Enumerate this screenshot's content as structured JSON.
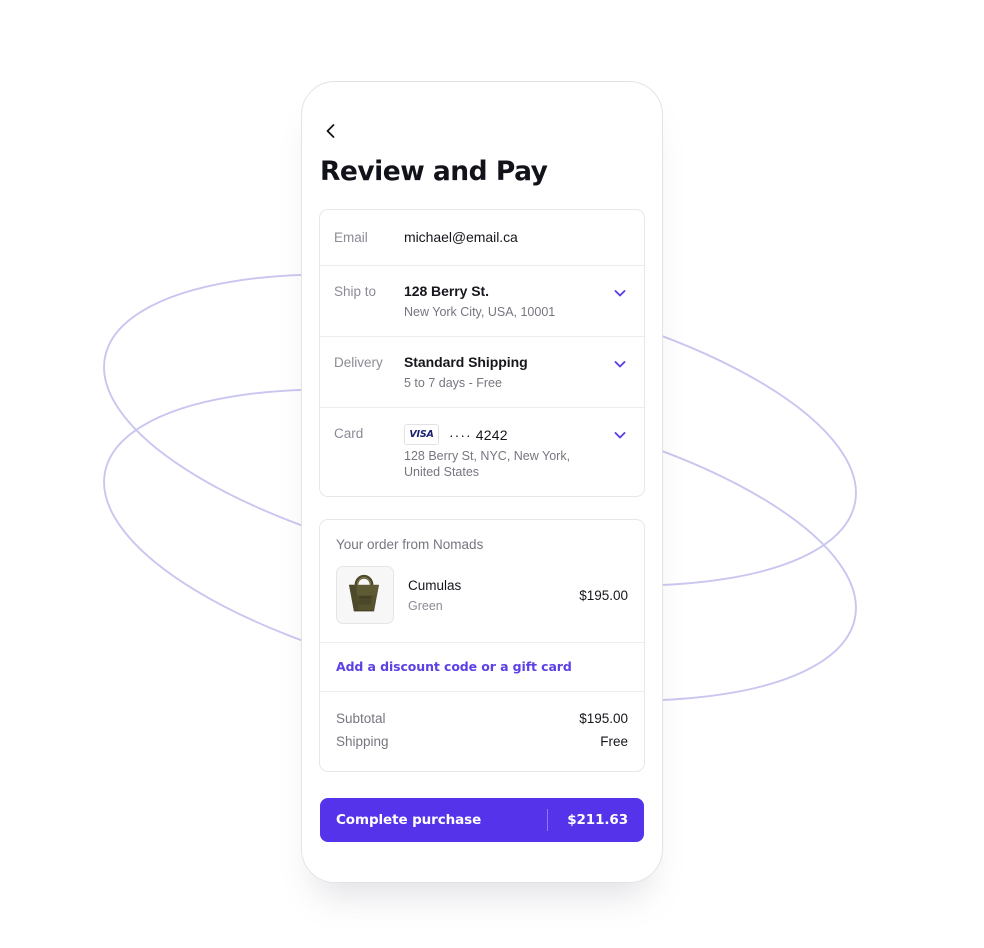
{
  "theme": {
    "accent": "#5433eb",
    "link": "#5b41e6",
    "chevron": "#5b41e6",
    "deco_stroke": "#c9c6f0",
    "page_bg": "#ffffff",
    "text_primary": "#16161d",
    "text_muted": "#8b8b96",
    "visa_navy": "#1a1f71"
  },
  "header": {
    "back_icon": "chevron-left-icon",
    "title": "Review and Pay"
  },
  "details": {
    "rows": [
      {
        "label": "Email",
        "primary": "michael@email.ca",
        "secondary": "",
        "has_chevron": false,
        "chevron_icon": ""
      },
      {
        "label": "Ship to",
        "primary": "128 Berry St.",
        "secondary": "New York City, USA, 10001",
        "has_chevron": true,
        "chevron_icon": "chevron-down-icon"
      },
      {
        "label": "Delivery",
        "primary": "Standard Shipping",
        "secondary": "5 to 7 days - Free",
        "has_chevron": true,
        "chevron_icon": "chevron-down-icon"
      }
    ],
    "card_row": {
      "label": "Card",
      "brand": "VISA",
      "brand_icon": "visa-card-icon",
      "dots": "····",
      "last4": "4242",
      "billing_line1": "128 Berry St, NYC, New York,",
      "billing_line2": "United States",
      "has_chevron": true,
      "chevron_icon": "chevron-down-icon"
    }
  },
  "order": {
    "heading": "Your order from Nomads",
    "items": [
      {
        "name": "Cumulas",
        "variant": "Green",
        "price": "$195.00",
        "image_alt": "green-tote-bag-thumbnail"
      }
    ],
    "discount_link": "Add a discount code or a gift card",
    "totals": [
      {
        "label": "Subtotal",
        "value": "$195.00"
      },
      {
        "label": "Shipping",
        "value": "Free"
      }
    ]
  },
  "footer": {
    "cta_label": "Complete purchase",
    "cta_amount": "$211.63"
  }
}
